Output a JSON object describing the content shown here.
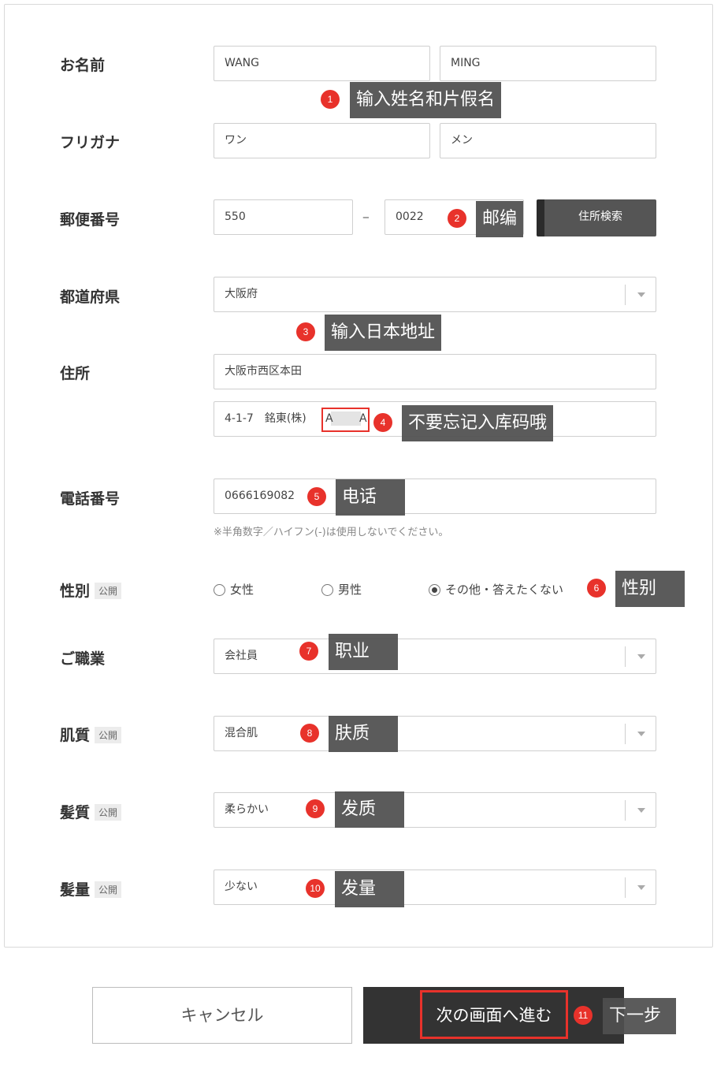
{
  "form": {
    "name": {
      "label": "お名前",
      "last": "WANG",
      "first": "MING"
    },
    "kana": {
      "label": "フリガナ",
      "last": "ワン",
      "first": "メン"
    },
    "postal": {
      "label": "郵便番号",
      "part1": "550",
      "dash": "−",
      "part2": "0022",
      "search_button": "住所検索"
    },
    "prefecture": {
      "label": "都道府県",
      "value": "大阪府"
    },
    "address": {
      "label": "住所",
      "line1": "大阪市西区本田",
      "line2": "4-1-7　銘東(株)",
      "line2_tail": "A",
      "line2_end": "A"
    },
    "phone": {
      "label": "電話番号",
      "value": "0666169082",
      "hint": "※半角数字／ハイフン(-)は使用しないでください。"
    },
    "gender": {
      "label": "性別",
      "badge": "公開",
      "options": [
        "女性",
        "男性",
        "その他・答えたくない"
      ],
      "selected": "その他・答えたくない"
    },
    "occupation": {
      "label": "ご職業",
      "value": "会社員"
    },
    "skin": {
      "label": "肌質",
      "badge": "公開",
      "value": "混合肌"
    },
    "hair_quality": {
      "label": "髪質",
      "badge": "公開",
      "value": "柔らかい"
    },
    "hair_amount": {
      "label": "髪量",
      "badge": "公開",
      "value": "少ない"
    }
  },
  "buttons": {
    "cancel": "キャンセル",
    "next": "次の画面へ進む"
  },
  "annotations": [
    {
      "num": "1",
      "text": "输入姓名和片假名"
    },
    {
      "num": "2",
      "text": "邮编"
    },
    {
      "num": "3",
      "text": "输入日本地址"
    },
    {
      "num": "4",
      "text": "不要忘记入库码哦"
    },
    {
      "num": "5",
      "text": "电话"
    },
    {
      "num": "6",
      "text": "性别"
    },
    {
      "num": "7",
      "text": "职业"
    },
    {
      "num": "8",
      "text": "肤质"
    },
    {
      "num": "9",
      "text": "发质"
    },
    {
      "num": "10",
      "text": "发量"
    },
    {
      "num": "11",
      "text": "下一步"
    }
  ],
  "colors": {
    "annotation_red": "#e8322b",
    "tag_bg": "#4f4f4f",
    "next_bg": "#333333"
  }
}
